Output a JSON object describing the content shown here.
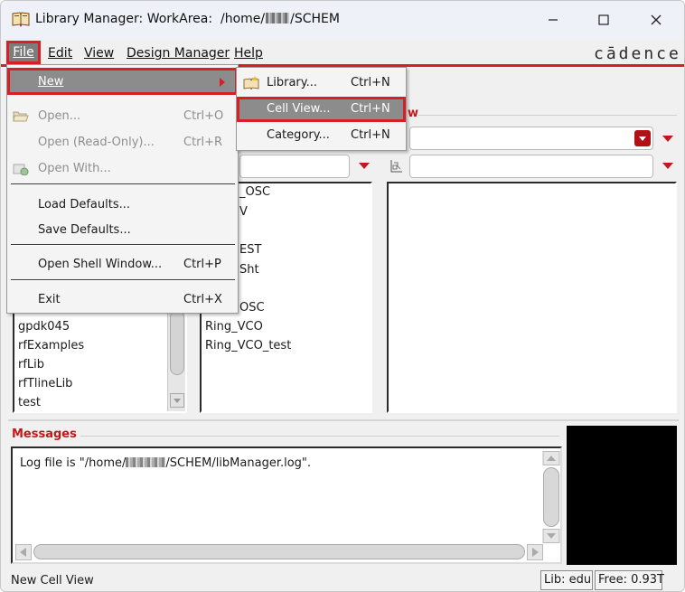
{
  "window": {
    "title_prefix": "Library Manager: WorkArea:  /home/",
    "title_suffix": "/SCHEM"
  },
  "menubar": {
    "file": "File",
    "edit": "Edit",
    "view": "View",
    "design_manager": "Design Manager",
    "help": "Help",
    "logo": "cādence"
  },
  "file_menu": {
    "new": "New",
    "open": "Open...",
    "open_shortcut": "Ctrl+O",
    "open_readonly": "Open (Read-Only)...",
    "open_readonly_shortcut": "Ctrl+R",
    "open_with": "Open With...",
    "load_defaults": "Load Defaults...",
    "save_defaults": "Save Defaults...",
    "open_shell": "Open Shell Window...",
    "open_shell_shortcut": "Ctrl+P",
    "exit": "Exit",
    "exit_shortcut": "Ctrl+X"
  },
  "new_submenu": {
    "library": "Library...",
    "library_shortcut": "Ctrl+N",
    "cell_view": "Cell View...",
    "cell_view_shortcut": "Ctrl+N",
    "category": "Category...",
    "category_shortcut": "Ctrl+N"
  },
  "panels": {
    "view_label_fragment": "w",
    "libraries": [
      "gpdk045",
      "rfExamples",
      "rfLib",
      "rfTlineLib",
      "test"
    ],
    "cells": [
      "_OSC",
      "V",
      "EST",
      "Sht",
      "OSC",
      "Ring_VCO",
      "Ring_VCO_test"
    ]
  },
  "messages": {
    "label": "Messages",
    "log_prefix": "Log file is \"/home/",
    "log_suffix": "/SCHEM/libManager.log\"."
  },
  "status": {
    "text": "New Cell View",
    "lib": "Lib: edu",
    "free": "Free: 0.93T"
  },
  "colors": {
    "accent_red": "#d61f26",
    "highlight_gray": "#8c8c8c"
  }
}
